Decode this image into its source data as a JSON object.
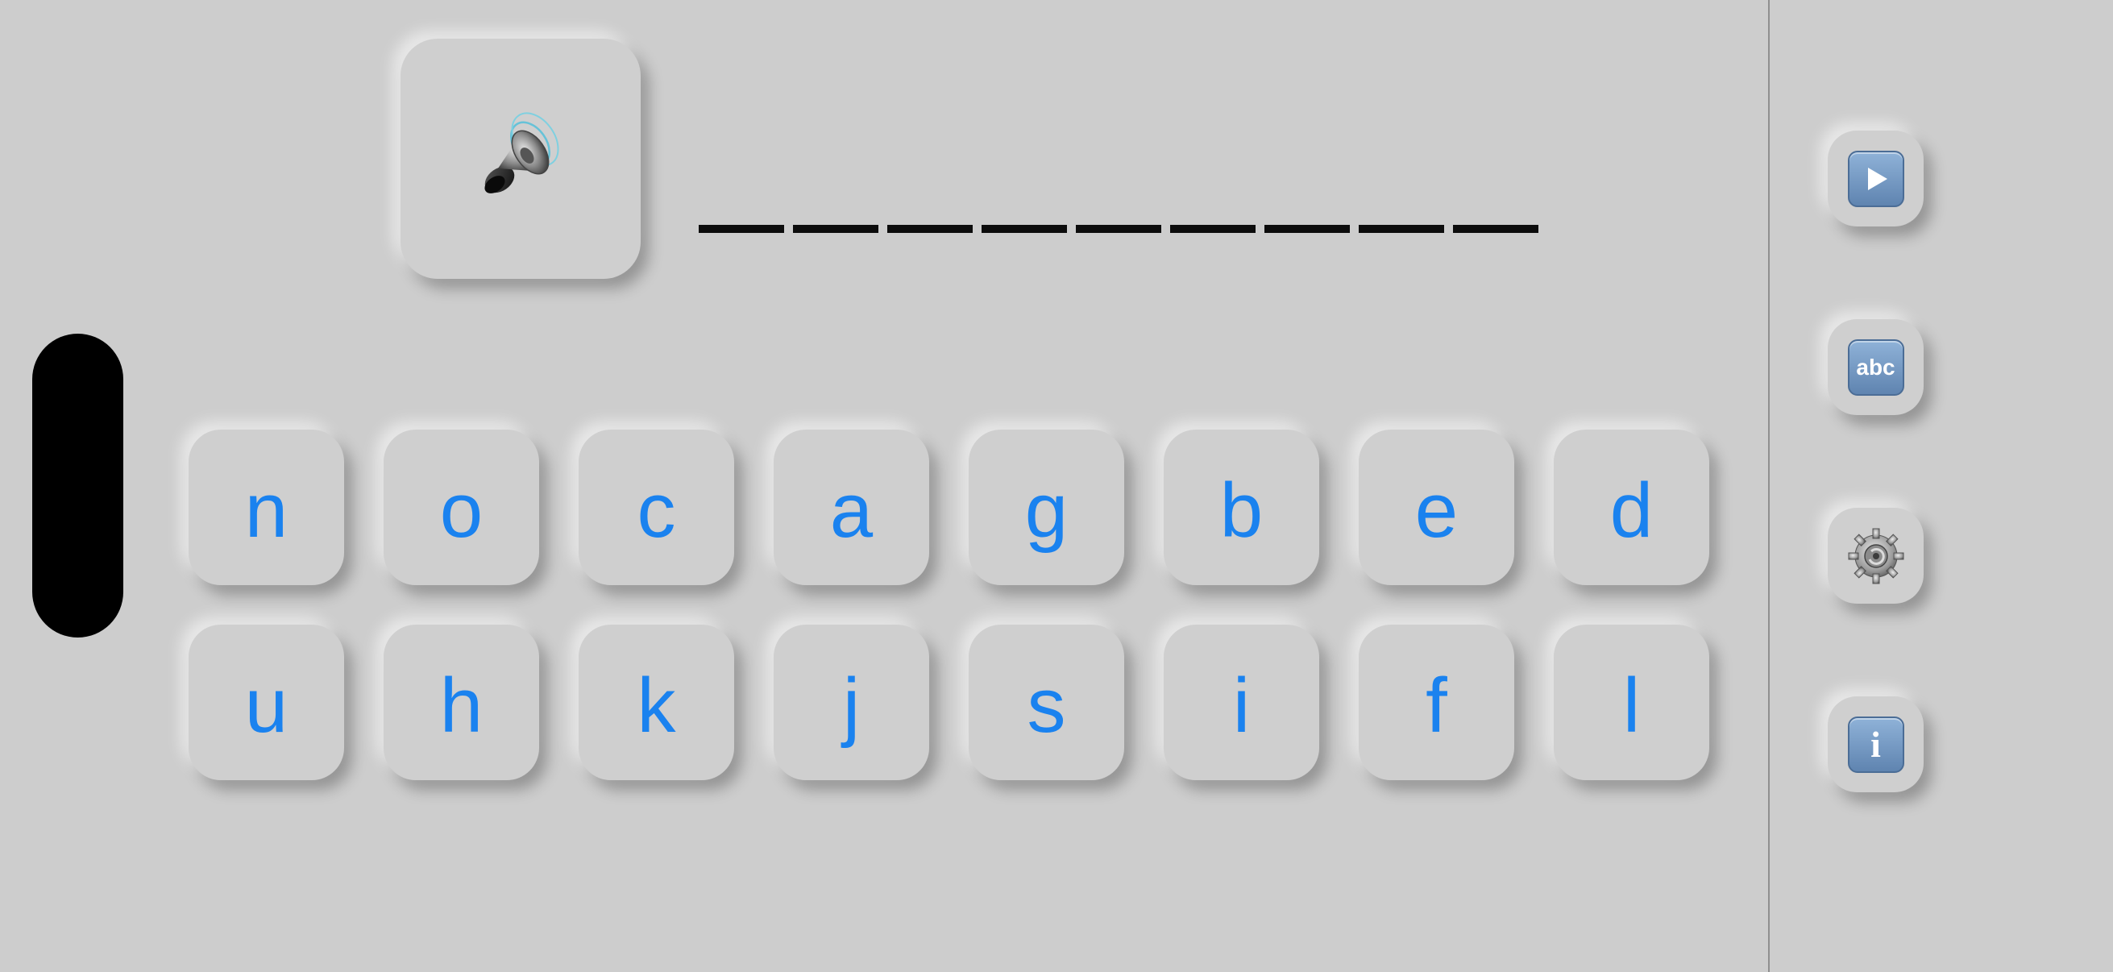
{
  "word": {
    "blank_count": 9
  },
  "speaker": {
    "icon": "speaker-icon"
  },
  "letters": {
    "row1": [
      "n",
      "o",
      "c",
      "a",
      "g",
      "b",
      "e",
      "d"
    ],
    "row2": [
      "u",
      "h",
      "k",
      "j",
      "s",
      "i",
      "f",
      "l"
    ],
    "color": "#1a82ef"
  },
  "sidebar": {
    "buttons": [
      {
        "icon": "play-icon"
      },
      {
        "icon": "abc-icon",
        "label": "abc"
      },
      {
        "icon": "gear-icon"
      },
      {
        "icon": "info-icon",
        "label": "i"
      }
    ]
  }
}
